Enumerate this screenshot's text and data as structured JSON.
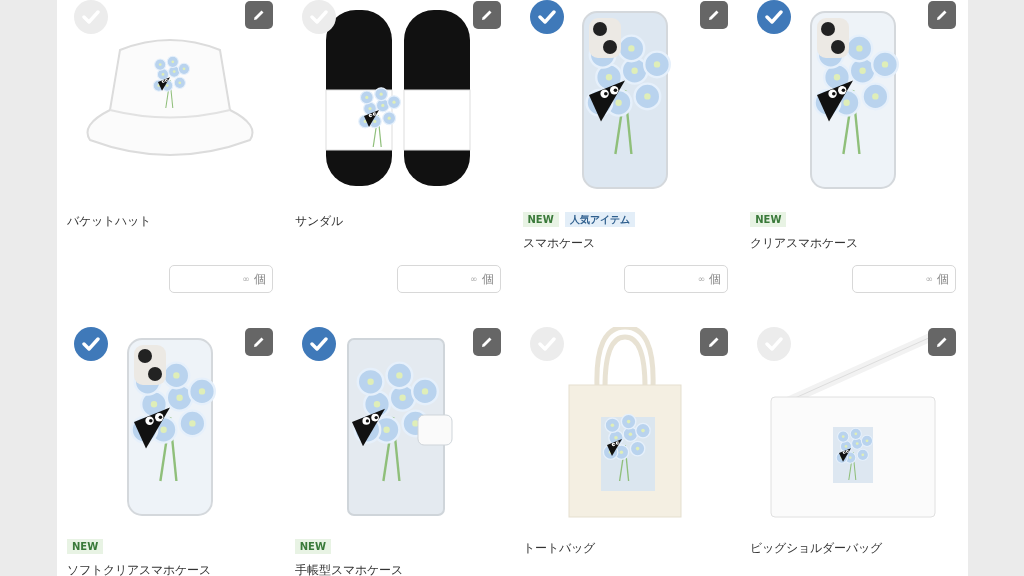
{
  "items": [
    {
      "kind": "hat",
      "selected": false,
      "name": "バケットハット",
      "quantity": {
        "placeholder": "∞",
        "unit": "個"
      }
    },
    {
      "kind": "sandal",
      "selected": false,
      "name": "サンダル",
      "quantity": {
        "placeholder": "∞",
        "unit": "個"
      }
    },
    {
      "kind": "phone",
      "selected": true,
      "badges": [
        {
          "label": "NEW",
          "kind": "new"
        },
        {
          "label": "人気アイテム",
          "kind": "popular"
        }
      ],
      "name": "スマホケース",
      "quantity": {
        "placeholder": "∞",
        "unit": "個"
      }
    },
    {
      "kind": "clear-phone",
      "selected": true,
      "badges": [
        {
          "label": "NEW",
          "kind": "new"
        }
      ],
      "name": "クリアスマホケース",
      "quantity": {
        "placeholder": "∞",
        "unit": "個"
      }
    },
    {
      "kind": "clear-phone",
      "selected": true,
      "badges": [
        {
          "label": "NEW",
          "kind": "new"
        }
      ],
      "name": "ソフトクリアスマホケース"
    },
    {
      "kind": "notebook",
      "selected": true,
      "badges": [
        {
          "label": "NEW",
          "kind": "new"
        }
      ],
      "name": "手帳型スマホケース"
    },
    {
      "kind": "tote",
      "selected": false,
      "name": "トートバッグ"
    },
    {
      "kind": "shoulder-bag",
      "selected": false,
      "name": "ビッグショルダーバッグ"
    }
  ]
}
